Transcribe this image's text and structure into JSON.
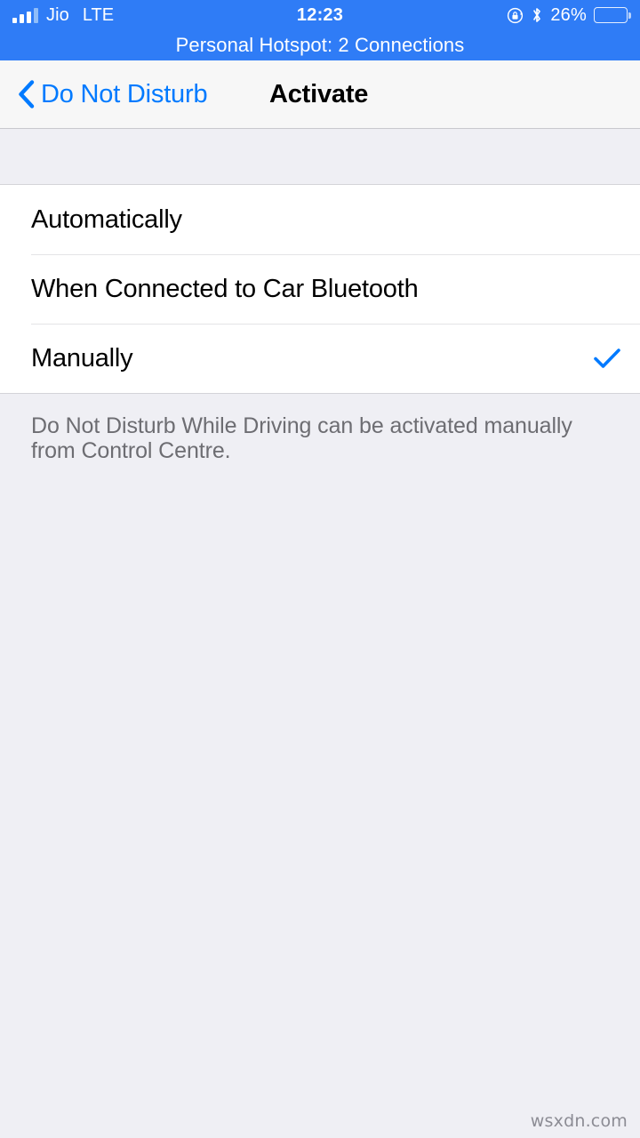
{
  "status_bar": {
    "carrier": "Jio",
    "network_type": "LTE",
    "time": "12:23",
    "battery_percent_label": "26%",
    "battery_level": 26,
    "signal_bars_filled": 3,
    "signal_bars_total": 4,
    "icons": [
      "rotation-lock-icon",
      "bluetooth-icon",
      "battery-icon"
    ],
    "hotspot_banner": "Personal Hotspot: 2 Connections",
    "background_color": "#2F7CF6"
  },
  "nav_bar": {
    "back_label": "Do Not Disturb",
    "back_icon": "chevron-left-icon",
    "title": "Activate",
    "tint_color": "#007AFF"
  },
  "list": {
    "options": [
      {
        "label": "Automatically",
        "selected": false
      },
      {
        "label": "When Connected to Car Bluetooth",
        "selected": false
      },
      {
        "label": "Manually",
        "selected": true
      }
    ],
    "checkmark_color": "#007AFF"
  },
  "footer": {
    "note": "Do Not Disturb While Driving can be activated manually from Control Centre."
  },
  "watermark": {
    "text": "wsxdn.com"
  }
}
